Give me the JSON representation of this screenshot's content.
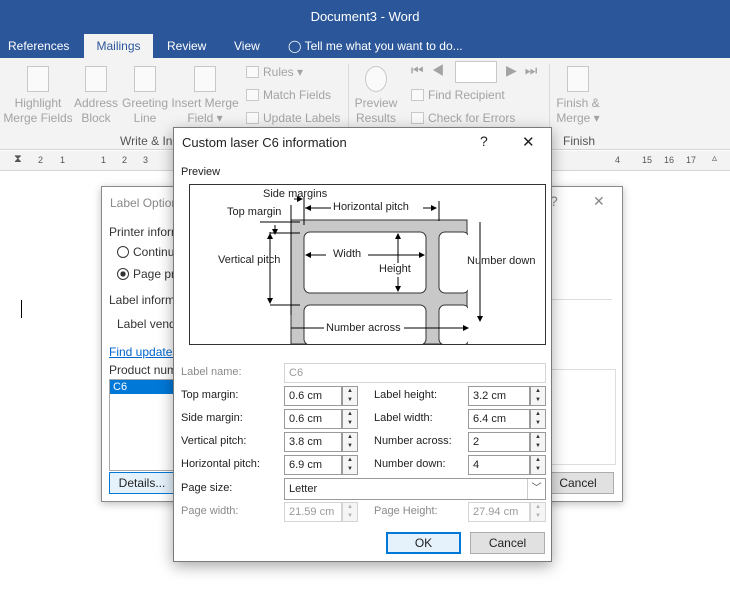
{
  "window": {
    "title": "Document3 - Word"
  },
  "tabs": [
    "References",
    "Mailings",
    "Review",
    "View"
  ],
  "tell_me": "Tell me what you want to do...",
  "ribbon": {
    "highlight": [
      "Highlight",
      "Merge Fields"
    ],
    "address": [
      "Address",
      "Block"
    ],
    "greeting": [
      "Greeting",
      "Line"
    ],
    "insert": [
      "Insert Merge",
      "Field ▾"
    ],
    "rules": "Rules ▾",
    "match": "Match Fields",
    "update": "Update Labels",
    "preview": [
      "Preview",
      "Results"
    ],
    "find": "Find Recipient",
    "check": "Check for Errors",
    "finish": [
      "Finish &",
      "Merge ▾"
    ],
    "group_write": "Write & In",
    "group_finish": "Finish"
  },
  "ruler": [
    "2",
    "1",
    "1",
    "2",
    "3",
    "4",
    "15",
    "16",
    "17"
  ],
  "bg_dialog": {
    "title": "Label Options",
    "printer": "Printer inform",
    "continuous": "Continu",
    "page": "Page pr",
    "label_info": "Label informa",
    "vendor": "Label vendo",
    "find": "Find updates",
    "product": "Product num",
    "item": "C6",
    "details": "Details...",
    "cancel": "Cancel",
    "help": "?",
    "close": "✕"
  },
  "dialog": {
    "title": "Custom laser C6 information",
    "help": "?",
    "close": "✕",
    "preview_label": "Preview",
    "diagram": {
      "side_margins": "Side margins",
      "top_margin": "Top margin",
      "horizontal_pitch": "Horizontal pitch",
      "vertical_pitch": "Vertical pitch",
      "width": "Width",
      "height": "Height",
      "number_down": "Number down",
      "number_across": "Number across"
    },
    "label_name": {
      "label": "Label name:",
      "value": "C6"
    },
    "top_margin": {
      "label": "Top margin:",
      "value": "0.6 cm"
    },
    "side_margin": {
      "label": "Side margin:",
      "value": "0.6 cm"
    },
    "vertical_pitch": {
      "label": "Vertical pitch:",
      "value": "3.8 cm"
    },
    "horizontal_pitch": {
      "label": "Horizontal pitch:",
      "value": "6.9 cm"
    },
    "label_height": {
      "label": "Label height:",
      "value": "3.2 cm"
    },
    "label_width": {
      "label": "Label width:",
      "value": "6.4 cm"
    },
    "number_across": {
      "label": "Number across:",
      "value": "2"
    },
    "number_down": {
      "label": "Number down:",
      "value": "4"
    },
    "page_size": {
      "label": "Page size:",
      "value": "Letter"
    },
    "page_width": {
      "label": "Page width:",
      "value": "21.59 cm"
    },
    "page_height": {
      "label": "Page Height:",
      "value": "27.94 cm"
    },
    "ok": "OK",
    "cancel": "Cancel"
  },
  "colors": {
    "accent": "#2b579a",
    "selection": "#0078d7",
    "link": "#0066cc"
  }
}
